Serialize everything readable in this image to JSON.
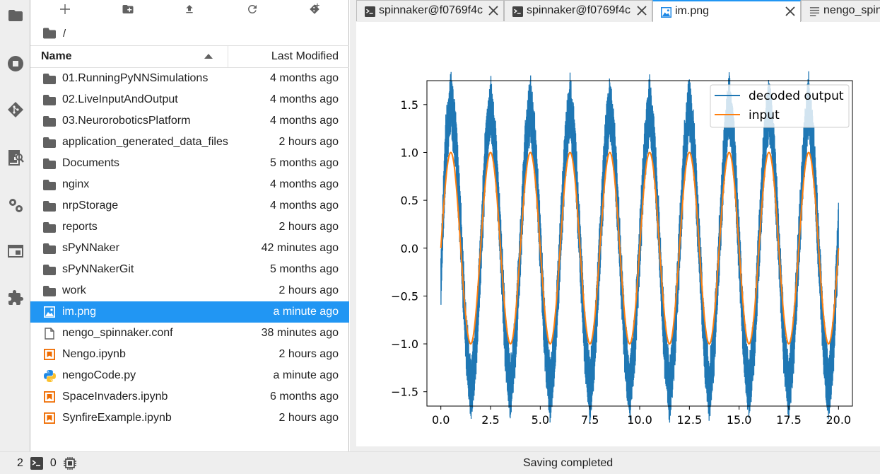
{
  "toolbar": {
    "buttons": [
      {
        "name": "new-launcher-button",
        "icon": "plus-icon"
      },
      {
        "name": "new-folder-button",
        "icon": "new-folder-icon"
      },
      {
        "name": "upload-button",
        "icon": "upload-icon"
      },
      {
        "name": "refresh-button",
        "icon": "refresh-icon"
      },
      {
        "name": "git-clone-button",
        "icon": "git-clone-icon"
      }
    ]
  },
  "breadcrumb": {
    "path": "/"
  },
  "list_header": {
    "name": "Name",
    "modified": "Last Modified"
  },
  "files": [
    {
      "type": "folder",
      "name": "01.RunningPyNNSimulations",
      "modified": "4 months ago"
    },
    {
      "type": "folder",
      "name": "02.LiveInputAndOutput",
      "modified": "4 months ago"
    },
    {
      "type": "folder",
      "name": "03.NeuroroboticsPlatform",
      "modified": "4 months ago"
    },
    {
      "type": "folder",
      "name": "application_generated_data_files",
      "modified": "2 hours ago"
    },
    {
      "type": "folder",
      "name": "Documents",
      "modified": "5 months ago"
    },
    {
      "type": "folder",
      "name": "nginx",
      "modified": "4 months ago"
    },
    {
      "type": "folder",
      "name": "nrpStorage",
      "modified": "4 months ago"
    },
    {
      "type": "folder",
      "name": "reports",
      "modified": "2 hours ago"
    },
    {
      "type": "folder",
      "name": "sPyNNaker",
      "modified": "42 minutes ago"
    },
    {
      "type": "folder",
      "name": "sPyNNakerGit",
      "modified": "5 months ago"
    },
    {
      "type": "folder",
      "name": "work",
      "modified": "2 hours ago"
    },
    {
      "type": "image",
      "name": "im.png",
      "modified": "a minute ago",
      "selected": true
    },
    {
      "type": "file",
      "name": "nengo_spinnaker.conf",
      "modified": "38 minutes ago"
    },
    {
      "type": "notebook",
      "name": "Nengo.ipynb",
      "modified": "2 hours ago"
    },
    {
      "type": "python",
      "name": "nengoCode.py",
      "modified": "a minute ago"
    },
    {
      "type": "notebook",
      "name": "SpaceInvaders.ipynb",
      "modified": "6 months ago"
    },
    {
      "type": "notebook",
      "name": "SynfireExample.ipynb",
      "modified": "2 hours ago"
    }
  ],
  "tabs": [
    {
      "type": "terminal",
      "label": "spinnaker@f0769f4c",
      "active": false,
      "closable": true
    },
    {
      "type": "terminal",
      "label": "spinnaker@f0769f4c",
      "active": false,
      "closable": true
    },
    {
      "type": "image",
      "label": "im.png",
      "active": true,
      "closable": true
    },
    {
      "type": "text",
      "label": "nengo_spinnaker.conf",
      "active": false,
      "closable": false
    }
  ],
  "activity_bar": [
    "folder-icon",
    "stop-circle-icon",
    "git-icon",
    "property-inspector-icon",
    "settings-icon",
    "tabs-icon",
    "extension-icon"
  ],
  "status_bar": {
    "count_a": "2",
    "count_b": "0",
    "message": "Saving completed"
  },
  "colors": {
    "accent": "#2196f3",
    "series_output": "#1f77b4",
    "series_input": "#ff7f0e"
  },
  "chart_data": {
    "type": "line",
    "title": "",
    "xlabel": "",
    "ylabel": "",
    "xlim": [
      -0.7,
      20.7
    ],
    "ylim": [
      -1.65,
      1.75
    ],
    "xticks": [
      0.0,
      2.5,
      5.0,
      7.5,
      10.0,
      12.5,
      15.0,
      17.5,
      20.0
    ],
    "xtick_labels": [
      "0.0",
      "2.5",
      "5.0",
      "7.5",
      "10.0",
      "12.5",
      "15.0",
      "17.5",
      "20.0"
    ],
    "yticks": [
      -1.5,
      -1.0,
      -0.5,
      0.0,
      0.5,
      1.0,
      1.5
    ],
    "ytick_labels": [
      "−1.5",
      "−1.0",
      "−0.5",
      "0.0",
      "0.5",
      "1.0",
      "1.5"
    ],
    "legend_position": "top-right",
    "grid": false,
    "series": [
      {
        "name": "decoded output",
        "color": "#1f77b4",
        "x": [
          0.0,
          0.25,
          0.5,
          0.75,
          1.0,
          1.25,
          1.5,
          1.75,
          2.0,
          2.25,
          2.5,
          2.75,
          3.0,
          3.25,
          3.5,
          3.75,
          4.0,
          4.25,
          4.5,
          4.75,
          5.0,
          5.25,
          5.5,
          5.75,
          6.0,
          6.25,
          6.5,
          6.75,
          7.0,
          7.25,
          7.5,
          7.75,
          8.0,
          8.25,
          8.5,
          8.75,
          9.0,
          9.25,
          9.5,
          9.75,
          10.0,
          10.25,
          10.5,
          10.75,
          11.0,
          11.25,
          11.5,
          11.75,
          12.0,
          12.25,
          12.5,
          12.75,
          13.0,
          13.25,
          13.5,
          13.75,
          14.0,
          14.25,
          14.5,
          14.75,
          15.0,
          15.25,
          15.5,
          15.75,
          16.0,
          16.25,
          16.5,
          16.75,
          17.0,
          17.25,
          17.5,
          17.75,
          18.0,
          18.25,
          18.5,
          18.75,
          19.0,
          19.25,
          19.5,
          19.75,
          20.0
        ],
        "y": [
          -0.3,
          1.05,
          1.55,
          1.1,
          0.2,
          -0.9,
          -1.5,
          -1.1,
          -0.1,
          1.0,
          1.5,
          1.0,
          0.1,
          -1.0,
          -1.5,
          -1.0,
          0.0,
          1.0,
          1.5,
          1.0,
          0.05,
          -1.0,
          -1.5,
          -1.0,
          0.0,
          1.0,
          1.5,
          1.0,
          0.0,
          -1.0,
          -1.5,
          -1.0,
          0.0,
          1.0,
          1.5,
          1.0,
          0.0,
          -1.0,
          -1.5,
          -1.0,
          0.0,
          1.0,
          1.5,
          1.0,
          0.0,
          -1.0,
          -1.5,
          -1.0,
          0.0,
          1.0,
          1.5,
          1.0,
          0.0,
          -1.0,
          -1.5,
          -1.0,
          0.0,
          1.0,
          1.5,
          1.0,
          0.0,
          -1.0,
          -1.5,
          -1.0,
          0.0,
          1.0,
          1.5,
          1.0,
          0.0,
          -1.0,
          -1.5,
          -1.0,
          0.0,
          1.0,
          1.5,
          1.0,
          0.0,
          -1.0,
          -1.5,
          -1.0,
          0.2
        ],
        "band_halfwidth": 0.35
      },
      {
        "name": "input",
        "color": "#ff7f0e",
        "function": "sin",
        "amplitude": 1.0,
        "period": 2.0,
        "x_range": [
          0,
          20
        ]
      }
    ]
  }
}
